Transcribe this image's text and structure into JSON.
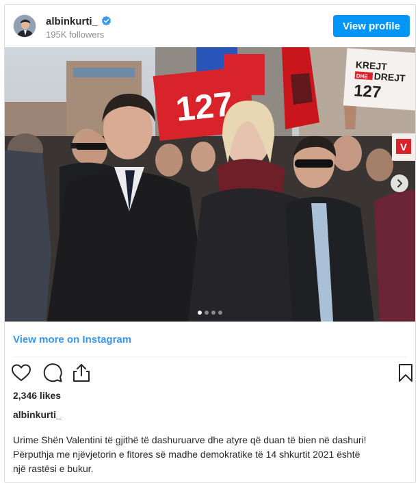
{
  "post": {
    "username": "albinkurti_",
    "followers": "195K followers",
    "view_profile_label": "View profile",
    "view_more_label": "View more on Instagram",
    "likes": "2,346 likes",
    "caption_user": "albinkurti_",
    "caption_lines": [
      "Urime Shën Valentini të gjithë të dashuruarve dhe atyre që duan të bien në dashuri!",
      "Përputhja me njëvjetorin e fitores së madhe demokratike të 14 shkurtit 2021 është",
      "një rastësi e bukur."
    ],
    "carousel": {
      "total_slides": 4,
      "active_slide": 1
    }
  },
  "photo_signs": {
    "sign_left": "127",
    "sign_right_line1": "KREJT",
    "sign_right_dhe": "DHE",
    "sign_right_line2": "DREJT",
    "sign_right_number": "127",
    "sign_small": "V"
  },
  "icons": {
    "verified": "verified-badge-icon",
    "like": "heart-icon",
    "comment": "comment-icon",
    "share": "share-icon",
    "save": "bookmark-icon",
    "next": "chevron-right-icon"
  },
  "colors": {
    "accent": "#0095f6",
    "link": "#3897f0",
    "sign_red": "#d8232a"
  }
}
